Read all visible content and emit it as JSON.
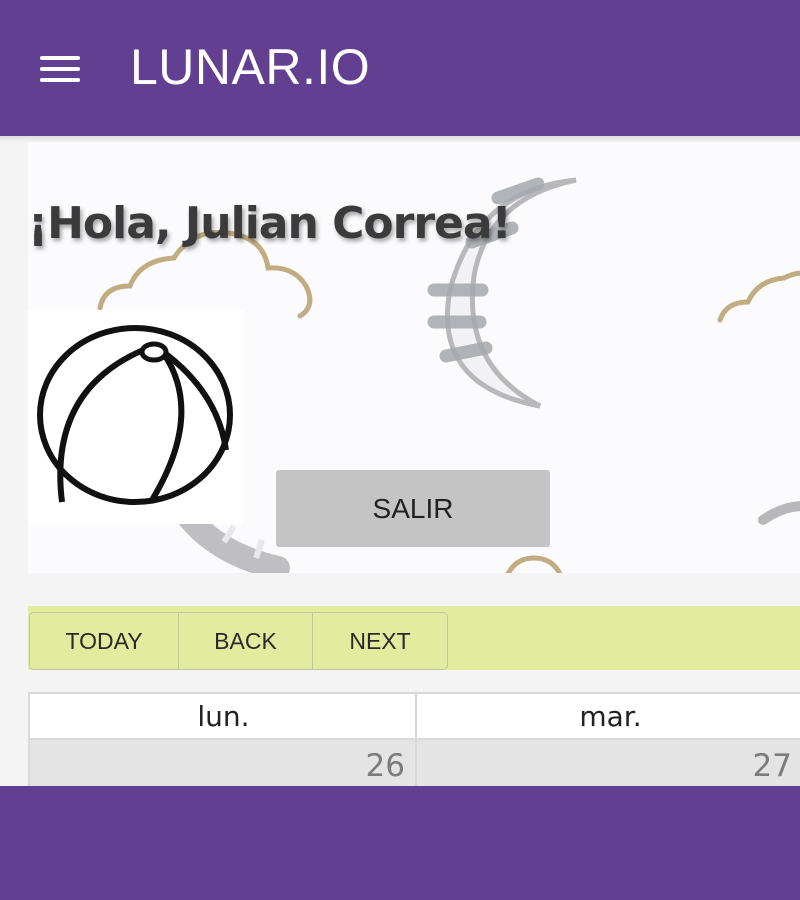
{
  "header": {
    "brand": "LUNAR.IO",
    "menu_icon": "hamburger-menu-icon",
    "bg_color": "#633f91"
  },
  "hero": {
    "greeting": "¡Hola, Julian Correa!",
    "avatar_icon": "beach-ball-icon",
    "logout_label": "SALIR"
  },
  "toolbar": {
    "today_label": "TODAY",
    "back_label": "BACK",
    "next_label": "NEXT",
    "bg_color": "#e1ec9f"
  },
  "calendar": {
    "days": [
      {
        "name": "lun.",
        "date": "26"
      },
      {
        "name": "mar.",
        "date": "27"
      }
    ]
  }
}
